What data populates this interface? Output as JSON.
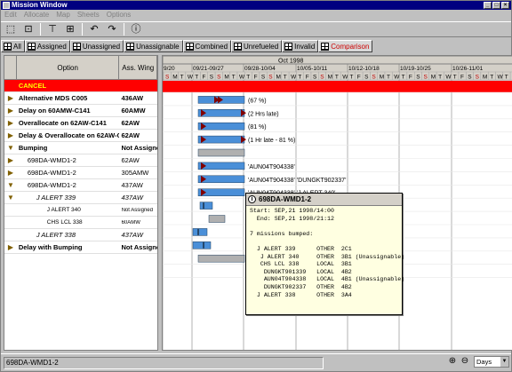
{
  "window": {
    "title": "Mission Window"
  },
  "menu": [
    "Edit",
    "Allocate",
    "Map",
    "Sheets",
    "Options"
  ],
  "toolbar": [
    "select-icon",
    "rect-select-icon",
    "filter-icon",
    "scale-icon",
    "undo-icon",
    "redo-icon",
    "info-icon"
  ],
  "tabs": [
    {
      "label": "All"
    },
    {
      "label": "Assigned"
    },
    {
      "label": "Unassigned"
    },
    {
      "label": "Unassignable"
    },
    {
      "label": "Combined"
    },
    {
      "label": "Unrefueled"
    },
    {
      "label": "Invalid"
    },
    {
      "label": "Comparison",
      "active": true
    }
  ],
  "table": {
    "headers": [
      "Option",
      "Ass. Wing"
    ],
    "rows": [
      {
        "icon": "",
        "option": "CANCEL",
        "wing": "",
        "style": "cancel"
      },
      {
        "icon": "▶",
        "option": "Alternative MDS C005",
        "wing": "436AW",
        "style": "b"
      },
      {
        "icon": "▶",
        "option": "Delay on 60AMW-C141",
        "wing": "60AMW",
        "style": "b"
      },
      {
        "icon": "▶",
        "option": "Overallocate on 62AW-C141",
        "wing": "62AW",
        "style": "b"
      },
      {
        "icon": "▶",
        "option": "Delay & Overallocate on 62AW-C141",
        "wing": "62AW",
        "style": "b"
      },
      {
        "icon": "▼",
        "option": "Bumping",
        "wing": "Not Assigned",
        "style": "b"
      },
      {
        "icon": "▶",
        "option": "698DA-WMD1-2",
        "wing": "62AW",
        "style": "n",
        "indent": 12
      },
      {
        "icon": "▶",
        "option": "698DA-WMD1-2",
        "wing": "305AMW",
        "style": "n",
        "indent": 12
      },
      {
        "icon": "▼",
        "option": "698DA-WMD1-2",
        "wing": "437AW",
        "style": "n",
        "indent": 12
      },
      {
        "icon": "▼",
        "option": "J ALERT 339",
        "wing": "437AW",
        "style": "i",
        "indent": 22
      },
      {
        "icon": "",
        "option": "J ALERT 340",
        "wing": "Not Assigned",
        "style": "s",
        "indent": 34
      },
      {
        "icon": "",
        "option": "CHS LCL 338",
        "wing": "60AMW",
        "style": "s",
        "indent": 34
      },
      {
        "icon": "",
        "option": "J ALERT 338",
        "wing": "437AW",
        "style": "i",
        "indent": 22
      },
      {
        "icon": "▶",
        "option": "Delay with Bumping",
        "wing": "Not Assigned",
        "style": "b"
      }
    ]
  },
  "gantt": {
    "month": "Oct 1998",
    "weeks": [
      "9/20",
      "09/21-09/27",
      "09/28-10/04",
      "10/05-10/11",
      "10/12-10/18",
      "10/19-10/25",
      "10/26-11/01"
    ],
    "day_letters": [
      "S",
      "M",
      "T",
      "W",
      "T",
      "F",
      "S"
    ],
    "bar_labels": [
      "(67 %)",
      "(2 Hrs late)",
      "(81 %)",
      "(1 Hr late - 81 %)",
      "",
      "'AUN04T904338'",
      "'AUN04T904338' 'DUNGKT902337'",
      "'AUN04T904338' 'J ALERT 340'"
    ]
  },
  "tooltip": {
    "title": "698DA-WMD1-2",
    "body": "Start: SEP,21 1998/14:00\n  End: SEP,21 1998/21:12\n\n7 missions bumped:\n\n  J ALERT 339      OTHER  2C1\n   J ALERT 340     OTHER  3B1 (Unassignable)\n   CHS LCL 338     LOCAL  3B1\n    DUNGKT901339   LOCAL  4B2\n    AUN04T904338   LOCAL  4B1 (Unassignable)\n    DUNGKT902337   OTHER  4B2\n  J ALERT 338      OTHER  3A4"
  },
  "status": {
    "text": "698DA-WMD1-2",
    "units": "Days"
  },
  "colors": {
    "bar": "#4a8fd8",
    "marker": "#800000",
    "cancel": "#ff0000",
    "titlebar": "#000080"
  }
}
